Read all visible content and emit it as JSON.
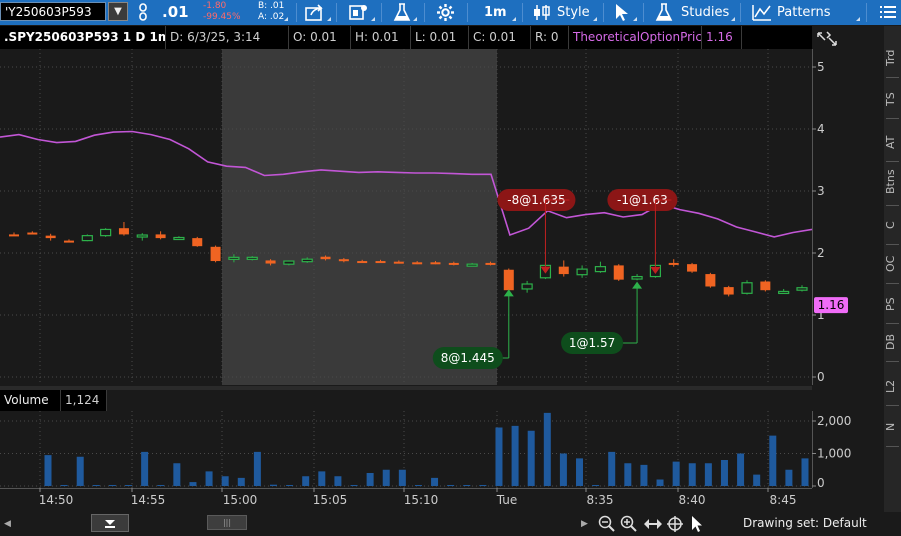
{
  "toolbar": {
    "symbol": "'Y250603P593",
    "last": ".01",
    "change": "-1.80",
    "change_pct": "-99.45%",
    "bid": "B: .01",
    "ask": "A: .02",
    "timeframe": "1m",
    "style_label": "Style",
    "studies_label": "Studies",
    "patterns_label": "Patterns"
  },
  "header": {
    "title": ".SPY250603P593 1 D 1m",
    "date": "D: 6/3/25, 3:14",
    "open": "O: 0.01",
    "high": "H: 0.01",
    "low": "L: 0.01",
    "close": "C: 0.01",
    "range": "R: 0",
    "study_name": "TheoreticalOptionPrice",
    "study_value": "1.16"
  },
  "volume": {
    "label": "Volume",
    "value": "1,124"
  },
  "sidebar_tabs": [
    "Trd",
    "TS",
    "AT",
    "Btns",
    "C",
    "OC",
    "PS",
    "DB",
    "L2",
    "N"
  ],
  "drawing_set": "Drawing set: Default",
  "colors": {
    "up": "#2db14a",
    "down": "#f06422",
    "study": "#c256d6",
    "volume": "#1f5a9e",
    "sell_tag": "#8c1616",
    "buy_tag": "#0e4d1c"
  },
  "chart_data": {
    "type": "candlestick",
    "price_axis": {
      "ylim": [
        0,
        5
      ],
      "ticks": [
        "0",
        "1",
        "2",
        "3",
        "4",
        "5"
      ]
    },
    "volume_axis": {
      "ylim": [
        0,
        2000
      ],
      "ticks": [
        "2,000",
        "1,000",
        "0"
      ]
    },
    "time_ticks": [
      "14:50",
      "14:55",
      "15:00",
      "15:05",
      "15:10",
      "Tue",
      "8:35",
      "8:40",
      "8:45"
    ],
    "candles": [
      {
        "o": 2.3,
        "h": 2.33,
        "l": 2.28,
        "c": 2.3,
        "d": "down"
      },
      {
        "o": 2.33,
        "h": 2.35,
        "l": 2.31,
        "c": 2.32,
        "d": "down"
      },
      {
        "o": 2.28,
        "h": 2.31,
        "l": 2.2,
        "c": 2.24,
        "d": "down"
      },
      {
        "o": 2.2,
        "h": 2.22,
        "l": 2.17,
        "c": 2.17,
        "d": "down"
      },
      {
        "o": 2.2,
        "h": 2.3,
        "l": 2.19,
        "c": 2.28,
        "d": "up"
      },
      {
        "o": 2.28,
        "h": 2.4,
        "l": 2.26,
        "c": 2.38,
        "d": "up"
      },
      {
        "o": 2.4,
        "h": 2.5,
        "l": 2.28,
        "c": 2.3,
        "d": "down"
      },
      {
        "o": 2.27,
        "h": 2.32,
        "l": 2.2,
        "c": 2.29,
        "d": "up"
      },
      {
        "o": 2.3,
        "h": 2.35,
        "l": 2.22,
        "c": 2.24,
        "d": "down"
      },
      {
        "o": 2.25,
        "h": 2.27,
        "l": 2.22,
        "c": 2.25,
        "d": "up"
      },
      {
        "o": 2.24,
        "h": 2.26,
        "l": 2.1,
        "c": 2.11,
        "d": "down"
      },
      {
        "o": 2.1,
        "h": 2.12,
        "l": 1.85,
        "c": 1.87,
        "d": "down"
      },
      {
        "o": 1.9,
        "h": 1.98,
        "l": 1.85,
        "c": 1.93,
        "d": "up"
      },
      {
        "o": 1.92,
        "h": 1.95,
        "l": 1.88,
        "c": 1.93,
        "d": "up"
      },
      {
        "o": 1.88,
        "h": 1.9,
        "l": 1.8,
        "c": 1.83,
        "d": "down"
      },
      {
        "o": 1.82,
        "h": 1.88,
        "l": 1.8,
        "c": 1.87,
        "d": "up"
      },
      {
        "o": 1.86,
        "h": 1.93,
        "l": 1.84,
        "c": 1.9,
        "d": "up"
      },
      {
        "o": 1.94,
        "h": 1.96,
        "l": 1.88,
        "c": 1.9,
        "d": "down"
      },
      {
        "o": 1.9,
        "h": 1.92,
        "l": 1.85,
        "c": 1.87,
        "d": "down"
      },
      {
        "o": 1.87,
        "h": 1.89,
        "l": 1.84,
        "c": 1.86,
        "d": "down"
      },
      {
        "o": 1.87,
        "h": 1.89,
        "l": 1.84,
        "c": 1.85,
        "d": "down"
      },
      {
        "o": 1.86,
        "h": 1.88,
        "l": 1.83,
        "c": 1.84,
        "d": "down"
      },
      {
        "o": 1.85,
        "h": 1.87,
        "l": 1.82,
        "c": 1.83,
        "d": "down"
      },
      {
        "o": 1.85,
        "h": 1.87,
        "l": 1.82,
        "c": 1.84,
        "d": "down"
      },
      {
        "o": 1.84,
        "h": 1.86,
        "l": 1.8,
        "c": 1.81,
        "d": "down"
      },
      {
        "o": 1.82,
        "h": 1.84,
        "l": 1.8,
        "c": 1.82,
        "d": "up"
      },
      {
        "o": 1.84,
        "h": 1.86,
        "l": 1.8,
        "c": 1.81,
        "d": "down"
      },
      {
        "o": 1.73,
        "h": 1.75,
        "l": 1.35,
        "c": 1.4,
        "d": "down"
      },
      {
        "o": 1.42,
        "h": 1.55,
        "l": 1.36,
        "c": 1.5,
        "d": "up"
      },
      {
        "o": 1.6,
        "h": 1.85,
        "l": 1.58,
        "c": 1.8,
        "d": "up"
      },
      {
        "o": 1.78,
        "h": 1.88,
        "l": 1.62,
        "c": 1.66,
        "d": "down"
      },
      {
        "o": 1.65,
        "h": 1.8,
        "l": 1.6,
        "c": 1.74,
        "d": "up"
      },
      {
        "o": 1.7,
        "h": 1.86,
        "l": 1.68,
        "c": 1.78,
        "d": "up"
      },
      {
        "o": 1.8,
        "h": 1.82,
        "l": 1.55,
        "c": 1.57,
        "d": "down"
      },
      {
        "o": 1.58,
        "h": 1.66,
        "l": 1.56,
        "c": 1.62,
        "d": "up"
      },
      {
        "o": 1.62,
        "h": 1.84,
        "l": 1.6,
        "c": 1.8,
        "d": "up"
      },
      {
        "o": 1.84,
        "h": 1.9,
        "l": 1.78,
        "c": 1.82,
        "d": "down"
      },
      {
        "o": 1.82,
        "h": 1.84,
        "l": 1.68,
        "c": 1.7,
        "d": "down"
      },
      {
        "o": 1.66,
        "h": 1.68,
        "l": 1.44,
        "c": 1.46,
        "d": "down"
      },
      {
        "o": 1.45,
        "h": 1.47,
        "l": 1.3,
        "c": 1.33,
        "d": "down"
      },
      {
        "o": 1.35,
        "h": 1.56,
        "l": 1.33,
        "c": 1.52,
        "d": "up"
      },
      {
        "o": 1.54,
        "h": 1.56,
        "l": 1.38,
        "c": 1.4,
        "d": "down"
      },
      {
        "o": 1.36,
        "h": 1.42,
        "l": 1.34,
        "c": 1.38,
        "d": "up"
      },
      {
        "o": 1.4,
        "h": 1.48,
        "l": 1.38,
        "c": 1.44,
        "d": "up"
      }
    ],
    "theoretical_price": [
      3.87,
      3.91,
      3.83,
      3.78,
      3.8,
      3.9,
      3.95,
      3.96,
      3.91,
      3.83,
      3.68,
      3.47,
      3.4,
      3.38,
      3.25,
      3.27,
      3.31,
      3.34,
      3.32,
      3.3,
      3.31,
      3.3,
      3.29,
      3.29,
      3.28,
      3.27,
      3.27,
      2.29,
      2.4,
      2.68,
      2.57,
      2.62,
      2.65,
      2.58,
      2.62,
      2.79,
      2.7,
      2.64,
      2.55,
      2.42,
      2.34,
      2.26,
      2.33,
      2.38
    ],
    "volume": [
      950,
      30,
      900,
      30,
      30,
      30,
      1050,
      30,
      700,
      120,
      450,
      300,
      250,
      1050,
      40,
      30,
      300,
      450,
      300,
      30,
      400,
      500,
      500,
      30,
      250,
      30,
      30,
      30,
      1800,
      1850,
      1700,
      2250,
      1000,
      850,
      30,
      1050,
      700,
      650,
      200,
      750,
      700,
      700,
      800,
      1000,
      350,
      1550,
      500,
      850
    ],
    "trades": [
      {
        "label": "-8@1.635",
        "side": "sell",
        "candle": 29,
        "price": 1.635
      },
      {
        "label": "-1@1.63",
        "side": "sell",
        "candle": 35,
        "price": 1.63
      },
      {
        "label": "8@1.445",
        "side": "buy",
        "candle": 27,
        "price": 1.445
      },
      {
        "label": "1@1.57",
        "side": "buy",
        "candle": 34,
        "price": 1.57
      }
    ],
    "last_price_label": "1.16"
  }
}
